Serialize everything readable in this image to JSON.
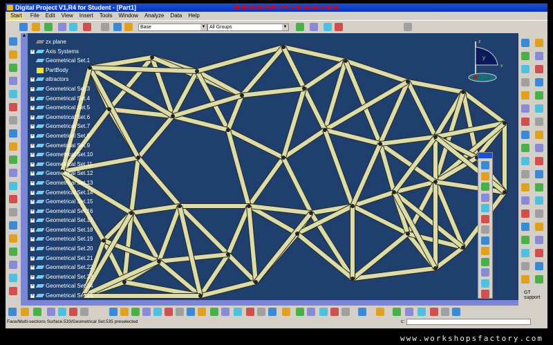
{
  "window": {
    "title": "Digital Project V1,R4 for Student - [Part1]",
    "recording_overlay": "11:02 11:01 ADMINPC srik ScreenHunter"
  },
  "menu": [
    "Start",
    "File",
    "Edit",
    "View",
    "Insert",
    "Tools",
    "Window",
    "Analyze",
    "Data",
    "Help"
  ],
  "toolbar": {
    "layer_select": "Base",
    "group_select": "All Groups"
  },
  "tree": [
    {
      "label": "zx plane",
      "icon": "plane-icon",
      "expander": false
    },
    {
      "label": "Axis Systems",
      "icon": "axis-icon",
      "expander": true
    },
    {
      "label": "Geometrical Set.1",
      "icon": "geoset-icon",
      "expander": false
    },
    {
      "label": "PartBody",
      "icon": "partbody-icon",
      "expander": false
    },
    {
      "label": "attractors",
      "icon": "geoset-icon",
      "expander": true
    },
    {
      "label": "Geometrical Set.3",
      "icon": "geoset-icon",
      "expander": true
    },
    {
      "label": "Geometrical Set.4",
      "icon": "geoset-icon",
      "expander": true
    },
    {
      "label": "Geometrical Set.5",
      "icon": "geoset-icon",
      "expander": true
    },
    {
      "label": "Geometrical Set.6",
      "icon": "geoset-icon",
      "expander": true
    },
    {
      "label": "Geometrical Set.7",
      "icon": "geoset-icon",
      "expander": true
    },
    {
      "label": "Geometrical Set.8",
      "icon": "geoset-icon",
      "expander": true
    },
    {
      "label": "Geometrical Set.9",
      "icon": "geoset-icon",
      "expander": true
    },
    {
      "label": "Geometrical Set.10",
      "icon": "geoset-icon",
      "expander": true
    },
    {
      "label": "Geometrical Set.11",
      "icon": "geoset-icon",
      "expander": true
    },
    {
      "label": "Geometrical Set.12",
      "icon": "geoset-icon",
      "expander": true
    },
    {
      "label": "Geometrical Set.13",
      "icon": "geoset-icon",
      "expander": true
    },
    {
      "label": "Geometrical Set.14",
      "icon": "geoset-icon",
      "expander": true
    },
    {
      "label": "Geometrical Set.15",
      "icon": "geoset-icon",
      "expander": true
    },
    {
      "label": "Geometrical Set.16",
      "icon": "geoset-icon",
      "expander": true
    },
    {
      "label": "Geometrical Set.17",
      "icon": "geoset-icon",
      "expander": true
    },
    {
      "label": "Geometrical Set.18",
      "icon": "geoset-icon",
      "expander": true
    },
    {
      "label": "Geometrical Set.19",
      "icon": "geoset-icon",
      "expander": true
    },
    {
      "label": "Geometrical Set.20",
      "icon": "geoset-icon",
      "expander": true
    },
    {
      "label": "Geometrical Set.21",
      "icon": "geoset-icon",
      "expander": true
    },
    {
      "label": "Geometrical Set.22",
      "icon": "geoset-icon",
      "expander": true
    },
    {
      "label": "Geometrical Set.23",
      "icon": "geoset-icon",
      "expander": true
    },
    {
      "label": "Geometrical Set.24",
      "icon": "geoset-icon",
      "expander": true
    },
    {
      "label": "Geometrical Set.25",
      "icon": "geoset-icon",
      "expander": true
    }
  ],
  "compass": {
    "x": "x",
    "y": "y",
    "z": "z"
  },
  "gt_support": {
    "line1": "GT",
    "line2": "support"
  },
  "status": {
    "message": "Face/Multi-sections Surface.533/Geometrical Set.535 preselected",
    "command_label": "c:",
    "command_value": ""
  },
  "footer": "www.workshopsfactory.com",
  "colors": {
    "viewport": "#1f3f6e",
    "lattice": "#dcdcaa",
    "titlebar": "#1a50d8",
    "scrollbar": "#7b86d8"
  }
}
